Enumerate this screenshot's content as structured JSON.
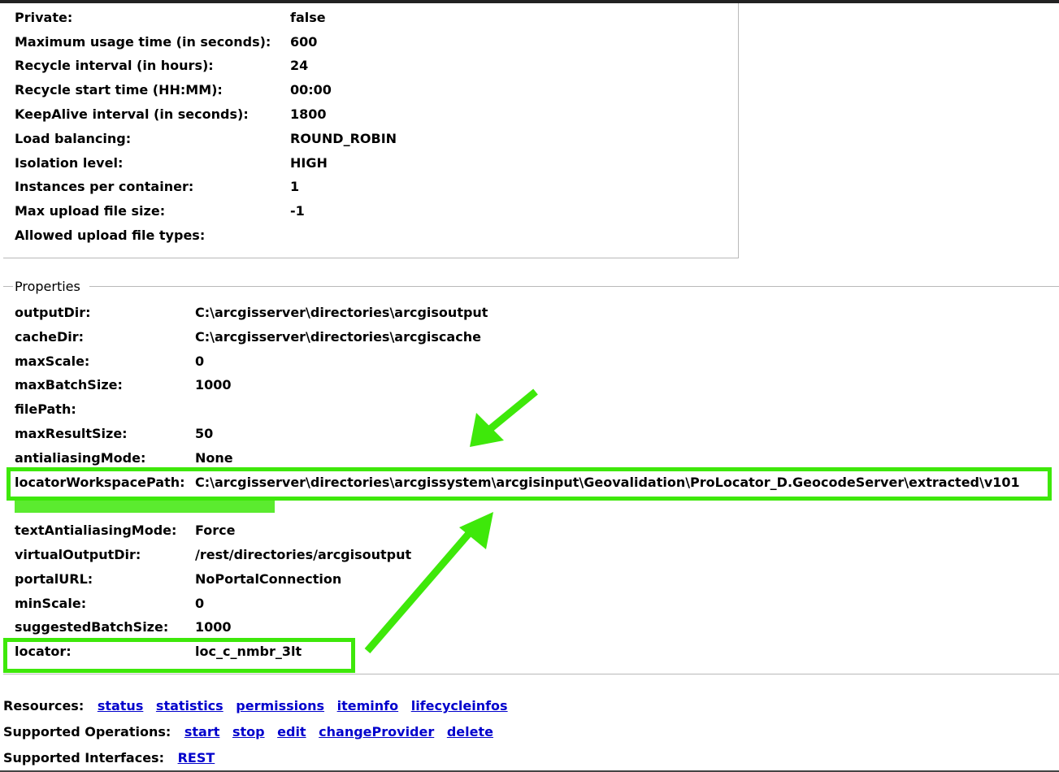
{
  "service_settings": [
    {
      "label": "Private:",
      "value": "false"
    },
    {
      "label": "Maximum usage time (in seconds):",
      "value": "600"
    },
    {
      "label": "Recycle interval (in hours):",
      "value": "24"
    },
    {
      "label": "Recycle start time (HH:MM):",
      "value": "00:00"
    },
    {
      "label": "KeepAlive interval (in seconds):",
      "value": "1800"
    },
    {
      "label": "Load balancing:",
      "value": "ROUND_ROBIN"
    },
    {
      "label": "Isolation level:",
      "value": "HIGH"
    },
    {
      "label": "Instances per container:",
      "value": "1"
    },
    {
      "label": "Max upload file size:",
      "value": "-1"
    },
    {
      "label": "Allowed upload file types:",
      "value": ""
    }
  ],
  "properties": {
    "legend": "Properties",
    "rows": [
      {
        "label": "outputDir:",
        "value": "C:\\arcgisserver\\directories\\arcgisoutput"
      },
      {
        "label": "cacheDir:",
        "value": "C:\\arcgisserver\\directories\\arcgiscache"
      },
      {
        "label": "maxScale:",
        "value": "0"
      },
      {
        "label": "maxBatchSize:",
        "value": "1000"
      },
      {
        "label": "filePath:",
        "value": ""
      },
      {
        "label": "maxResultSize:",
        "value": "50"
      },
      {
        "label": "antialiasingMode:",
        "value": "None"
      },
      {
        "label": "locatorWorkspacePath:",
        "value": "C:\\arcgisserver\\directories\\arcgissystem\\arcgisinput\\Geovalidation\\ProLocator_D.GeocodeServer\\extracted\\v101"
      },
      {
        "label": "textAntialiasingMode:",
        "value": "Force"
      },
      {
        "label": "virtualOutputDir:",
        "value": "/rest/directories/arcgisoutput"
      },
      {
        "label": "portalURL:",
        "value": "NoPortalConnection"
      },
      {
        "label": "minScale:",
        "value": "0"
      },
      {
        "label": "suggestedBatchSize:",
        "value": "1000"
      },
      {
        "label": "locator:",
        "value": "loc_c_nmbr_3lt"
      }
    ]
  },
  "footer": {
    "resources_label": "Resources:",
    "resources": [
      "status",
      "statistics",
      "permissions",
      "iteminfo",
      "lifecycleinfos"
    ],
    "operations_label": "Supported Operations:",
    "operations": [
      "start",
      "stop",
      "edit",
      "changeProvider",
      "delete"
    ],
    "interfaces_label": "Supported Interfaces:",
    "interfaces": [
      "REST"
    ]
  },
  "colors": {
    "highlight": "#3ee80a",
    "link": "#0000cc"
  }
}
